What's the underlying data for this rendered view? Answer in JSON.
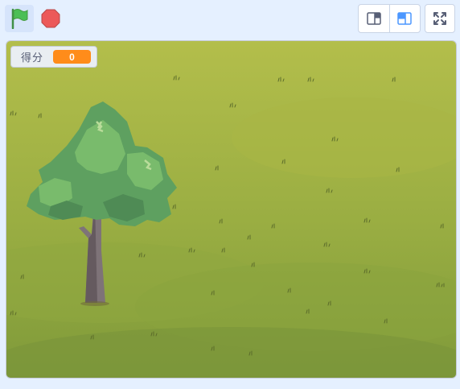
{
  "toolbar": {
    "green_flag_icon": "green-flag-icon",
    "stop_icon": "stop-sign-icon",
    "small_stage_icon": "small-stage-icon",
    "large_stage_icon": "large-stage-icon",
    "fullscreen_icon": "fullscreen-icon",
    "colors": {
      "flag": "#4cbf56",
      "stop": "#ec5959",
      "accent": "#4c97ff"
    }
  },
  "stage": {
    "monitor": {
      "label": "得分",
      "value": "0",
      "value_color": "#ff8c1a"
    },
    "backdrop_colors": {
      "top": "#b2be4a",
      "bottom": "#7f9a3a"
    }
  }
}
